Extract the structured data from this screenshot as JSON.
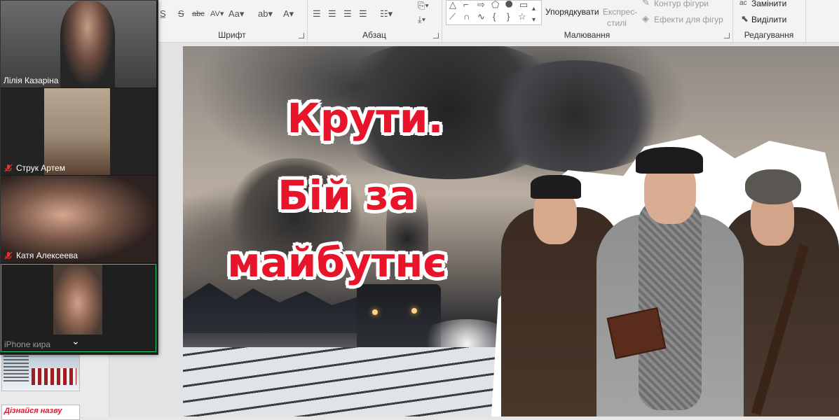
{
  "ribbon": {
    "groups": {
      "font": "Шрифт",
      "paragraph": "Абзац",
      "drawing": "Малювання",
      "editing": "Редагування"
    },
    "buttons": {
      "arrange": "Упорядкувати",
      "express_styles_1": "Експрес-",
      "express_styles_2": "стилі",
      "shape_outline": "Контур фігури",
      "shape_effects": "Ефекти для фігур",
      "replace": "Замінити",
      "select": "Виділити"
    }
  },
  "slide": {
    "title_line1": "Крути.",
    "title_line2": "Бій за",
    "title_line3": "майбутнє"
  },
  "thumbnails": {
    "slide2_title": "Дізнайся назву"
  },
  "zoom": {
    "participants": [
      {
        "name": "Лілія Казаріна",
        "muted": false
      },
      {
        "name": "Струк Артем",
        "muted": true
      },
      {
        "name": "Катя Алексеева",
        "muted": true
      },
      {
        "name": "iPhone кира",
        "muted": false
      }
    ]
  },
  "colors": {
    "title_red": "#e8142a",
    "active_speaker": "#2ecc71",
    "mute_red": "#e5312f"
  }
}
